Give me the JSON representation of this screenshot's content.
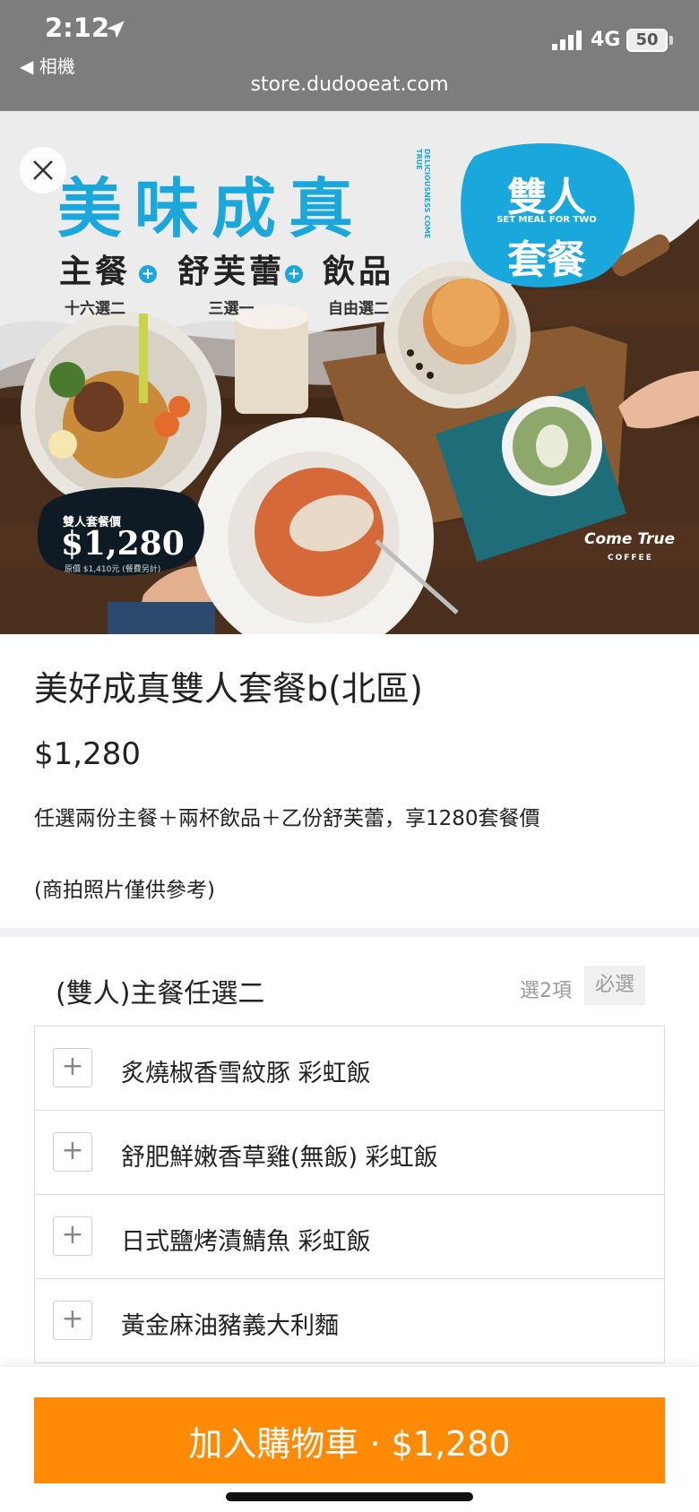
{
  "status_bar": {
    "time": "2:12",
    "back_app": "◀ 相機",
    "url": "store.dudooeat.com",
    "network": "4G",
    "battery": "50"
  },
  "banner": {
    "headline": "美味成真",
    "english_vertical": "DELICIOUSNESS COME TRUE",
    "combo": [
      {
        "main": "主餐",
        "sub": "十六選二"
      },
      {
        "main": "舒芙蕾",
        "sub": "三選一"
      },
      {
        "main": "飲品",
        "sub": "自由選二"
      }
    ],
    "plus_glyph": "+",
    "badge": {
      "line1": "雙人",
      "english": "SET MEAL FOR TWO",
      "line2": "套餐"
    },
    "price_tag": {
      "label": "雙人套餐價",
      "price": "$1,280",
      "original": "原價 $1,410元 (餐費另計)"
    },
    "brand": {
      "name": "Come True",
      "sub": "COFFEE"
    },
    "colors": {
      "accent": "#1aa7dc",
      "wood": "#5a3a22"
    }
  },
  "product": {
    "title": "美好成真雙人套餐b(北區)",
    "price": "$1,280",
    "description": "任選兩份主餐＋兩杯飲品＋乙份舒芙蕾，享1280套餐價",
    "note": "(商拍照片僅供參考)"
  },
  "option_group": {
    "title": "(雙人)主餐任選二",
    "count": "選2項",
    "required": "必選",
    "options": [
      {
        "label": "炙燒椒香雪紋豚 彩虹飯"
      },
      {
        "label": "舒肥鮮嫩香草雞(無飯) 彩虹飯"
      },
      {
        "label": "日式鹽烤漬鯖魚 彩虹飯"
      },
      {
        "label": "黃金麻油豬義大利麵"
      }
    ],
    "plus_glyph": "+"
  },
  "cart": {
    "label": "加入購物車 · $1,280",
    "color": "#ff8a06"
  }
}
